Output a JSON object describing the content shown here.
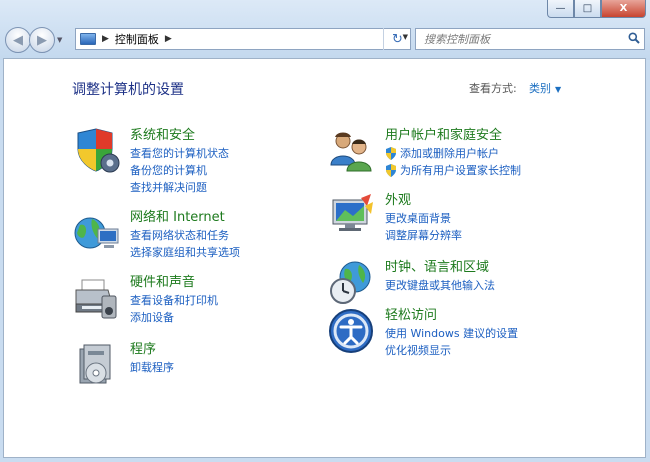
{
  "window": {
    "min_label": "—",
    "max_label": "□",
    "close_label": "X"
  },
  "nav": {
    "back_glyph": "◀",
    "forward_glyph": "▶",
    "drop_glyph": "▼"
  },
  "address": {
    "sep1": "▶",
    "path": "控制面板",
    "sep2": "▶",
    "drop": "▼",
    "refresh_glyph": "↻"
  },
  "search": {
    "placeholder": "搜索控制面板"
  },
  "header": {
    "title": "调整计算机的设置",
    "view_by_label": "查看方式:",
    "view_value": "类别"
  },
  "categories_left": [
    {
      "title": "系统和安全",
      "links": [
        "查看您的计算机状态",
        "备份您的计算机",
        "查找并解决问题"
      ]
    },
    {
      "title": "网络和 Internet",
      "links": [
        "查看网络状态和任务",
        "选择家庭组和共享选项"
      ]
    },
    {
      "title": "硬件和声音",
      "links": [
        "查看设备和打印机",
        "添加设备"
      ]
    },
    {
      "title": "程序",
      "links": [
        "卸载程序"
      ]
    }
  ],
  "categories_right": [
    {
      "title": "用户帐户和家庭安全",
      "links": [
        "添加或删除用户帐户",
        "为所有用户设置家长控制"
      ]
    },
    {
      "title": "外观",
      "links": [
        "更改桌面背景",
        "调整屏幕分辨率"
      ]
    },
    {
      "title": "时钟、语言和区域",
      "links": [
        "更改键盘或其他输入法"
      ]
    },
    {
      "title": "轻松访问",
      "links": [
        "使用 Windows 建议的设置",
        "优化视频显示"
      ]
    }
  ]
}
